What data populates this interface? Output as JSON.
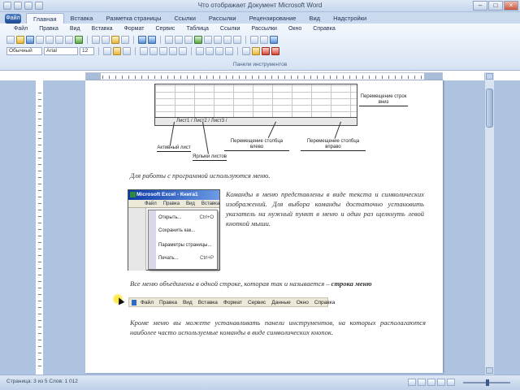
{
  "window": {
    "title": "Что отображает Документ Microsoft Word"
  },
  "ribbon": {
    "office_button": "Файл",
    "tabs": [
      "Главная",
      "Вставка",
      "Разметка страницы",
      "Ссылки",
      "Рассылки",
      "Рецензирование",
      "Вид",
      "Надстройки"
    ],
    "menu_items": [
      "Файл",
      "Правка",
      "Вид",
      "Вставка",
      "Формат",
      "Сервис",
      "Таблица",
      "Ссылки",
      "Рассылки",
      "Окно",
      "Справка"
    ],
    "style_combo": "Обычный",
    "font_combo": "Arial",
    "size_combo": "12",
    "group_label": "Панели инструментов"
  },
  "document": {
    "sheet_tabs": "Лист1 / Лист2 / Лист3 /",
    "callouts": {
      "active_sheet": "Активный лист",
      "sheet_tabs": "Ярлыки листов",
      "move_columns": "Перемещение столбца влево",
      "move_columns_right": "Перемещение столбца вправо",
      "move_rows": "Перемещение строк вниз"
    },
    "para_intro": "Для работы с программой используются меню.",
    "para_menu_desc": "Команды в меню представлены в виде текста и символических изображений. Для выбора команды достаточно установить указатель на нужный пункт в меню и один раз щелкнуть левой кнопкой мыши.",
    "para_menubar_a": "Все меню объединены в одной строке, которая так и называется – ",
    "para_menubar_b": "строка меню",
    "para_toolbars": "Кроме меню вы можете устанавливать панели инструментов, на которых располагаются наиболее часто используемые команды в виде символических кнопок."
  },
  "excel_menu": {
    "title": "Microsoft Excel - Книга1",
    "bar_items": [
      "Файл",
      "Правка",
      "Вид",
      "Вставка"
    ],
    "items": [
      {
        "label": "Открыть...",
        "shortcut": "Ctrl+O"
      },
      {
        "label": "Сохранить как...",
        "shortcut": ""
      },
      {
        "label": "Параметры страницы...",
        "shortcut": ""
      },
      {
        "label": "Печать...",
        "shortcut": "Ctrl+P"
      }
    ]
  },
  "menu_strip": {
    "items": [
      "Файл",
      "Правка",
      "Вид",
      "Вставка",
      "Формат",
      "Сервис",
      "Данные",
      "Окно",
      "Справка"
    ]
  },
  "status": {
    "text": "Страница: 3 из 5   Слов: 1 012"
  }
}
